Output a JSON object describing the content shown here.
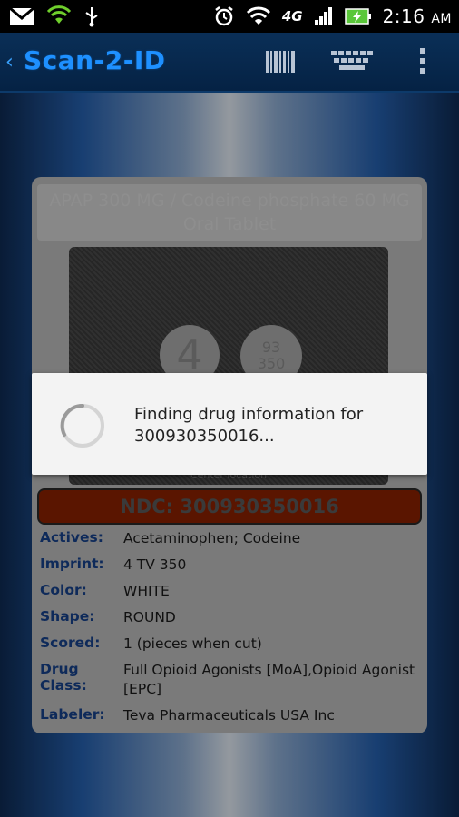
{
  "status_bar": {
    "time": "2:16",
    "ampm": "AM",
    "network": "4G",
    "icons": [
      "gmail-icon",
      "wifi-hotspot-icon",
      "usb-icon",
      "alarm-icon",
      "wifi-icon",
      "signal-icon",
      "battery-charging-icon"
    ]
  },
  "action_bar": {
    "title": "Scan-2-ID",
    "icons": [
      "barcode-icon",
      "keyboard-icon",
      "overflow-menu-icon"
    ]
  },
  "card": {
    "title": "APAP 300 MG / Codeine phosphate 60 MG Oral Tablet",
    "pill_left_imprint": "4",
    "pill_right_imprint_1": "93",
    "pill_right_imprint_2": "350",
    "image_caption": "Center location",
    "ndc": "NDC: 300930350016",
    "rows": [
      {
        "label": "Actives:",
        "value": "Acetaminophen;  Codeine"
      },
      {
        "label": "Imprint:",
        "value": "4 TV 350"
      },
      {
        "label": "Color:",
        "value": "WHITE"
      },
      {
        "label": "Shape:",
        "value": "ROUND"
      },
      {
        "label": "Scored:",
        "value": "1 (pieces when cut)"
      },
      {
        "label": "Drug Class:",
        "value": "Full Opioid Agonists [MoA],Opioid Agonist [EPC]"
      },
      {
        "label": "Labeler:",
        "value": "Teva Pharmaceuticals USA Inc"
      }
    ]
  },
  "dialog": {
    "message": "Finding drug information for 300930350016..."
  }
}
